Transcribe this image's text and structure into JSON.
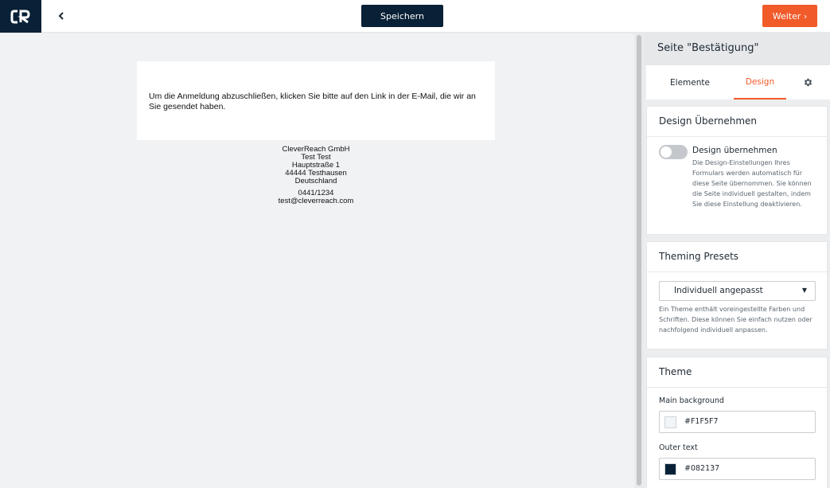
{
  "topbar": {
    "logo_text": "CR",
    "back_icon": "chevron-left-icon",
    "save_label": "Speichern",
    "next_label": "Weiter ›"
  },
  "canvas": {
    "message": "Um die Anmeldung abzuschließen, klicken Sie bitte auf den Link in der E-Mail, die wir an Sie gesendet haben.",
    "footer": {
      "company": "CleverReach GmbH",
      "name": "Test Test",
      "street": "Hauptstraße 1",
      "city": "44444 Testhausen",
      "country": "Deutschland",
      "phone": "0441/1234",
      "email": "test@cleverreach.com"
    }
  },
  "panel": {
    "title": "Seite \"Bestätigung\"",
    "tabs": [
      {
        "label": "Elemente",
        "active": false
      },
      {
        "label": "Design",
        "active": true
      }
    ],
    "settings_icon": "gear-icon",
    "design_section": {
      "title": "Design Übernehmen",
      "toggle_label": "Design übernehmen",
      "toggle_on": false,
      "description": "Die Design-Einstellungen Ihres Formulars werden automatisch für diese Seite übernommen. Sie können die Seite individuell gestalten, indem Sie diese Einstellung deaktivieren."
    },
    "presets_section": {
      "title": "Theming Presets",
      "selected": "Individuell angepasst",
      "description": "Ein Theme enthält voreingestellte Farben und Schriften. Diese können Sie einfach nutzen oder nachfolgend individuell anpassen."
    },
    "theme_section": {
      "title": "Theme",
      "fields": [
        {
          "label": "Main background",
          "value": "#F1F5F7",
          "color": "#F1F5F7"
        },
        {
          "label": "Outer text",
          "value": "#082137",
          "color": "#082137"
        }
      ]
    }
  },
  "colors": {
    "brand_dark": "#082137",
    "accent": "#f15a29"
  }
}
